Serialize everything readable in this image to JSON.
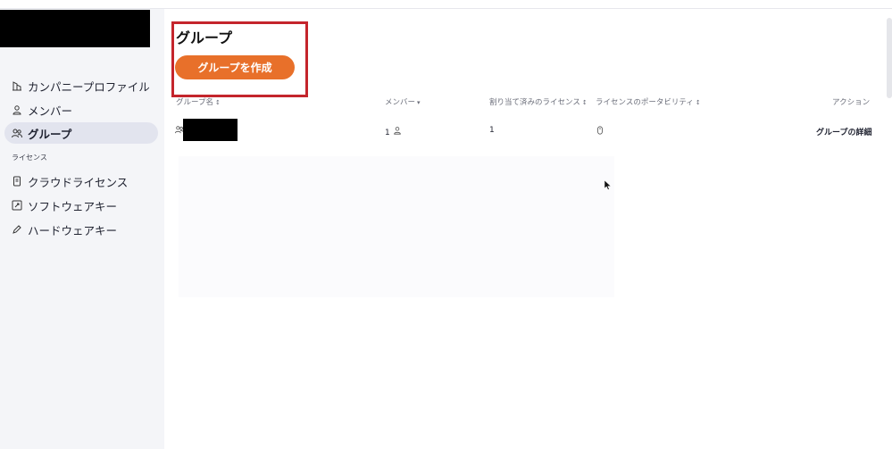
{
  "sidebar": {
    "items": [
      {
        "label": "カンパニープロファイル",
        "icon": "building-icon"
      },
      {
        "label": "メンバー",
        "icon": "person-icon"
      },
      {
        "label": "グループ",
        "icon": "group-icon"
      }
    ],
    "section_label": "ライセンス",
    "license_items": [
      {
        "label": "クラウドライセンス",
        "icon": "document-icon"
      },
      {
        "label": "ソフトウェアキー",
        "icon": "key-box-icon"
      },
      {
        "label": "ハードウェアキー",
        "icon": "pen-icon"
      }
    ]
  },
  "main": {
    "title": "グループ",
    "create_button": "グループを作成",
    "columns": {
      "group_name": "グループ名",
      "members": "メンバー",
      "assigned_licenses": "割り当て済みのライセンス",
      "license_portability": "ライセンスのポータビリティ",
      "action": "アクション"
    },
    "rows": [
      {
        "members": "1",
        "assigned": "1",
        "portability_icon": "mouse-icon",
        "action": "グループの詳細"
      }
    ]
  },
  "colors": {
    "accent": "#e8702a",
    "highlight": "#c4252c",
    "sidebar_bg": "#f4f5f8"
  }
}
